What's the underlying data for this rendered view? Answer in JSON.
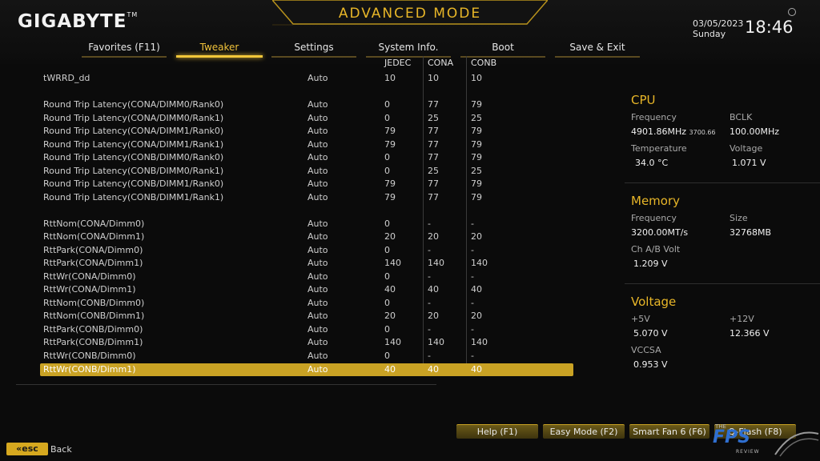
{
  "header": {
    "logo": "GIGABYTE",
    "logo_mark": "TM",
    "mode_title": "ADVANCED MODE",
    "date": "03/05/2023",
    "day": "Sunday",
    "time": "18:46"
  },
  "tabs": [
    {
      "label": "Favorites (F11)",
      "active": false
    },
    {
      "label": "Tweaker",
      "active": true
    },
    {
      "label": "Settings",
      "active": false
    },
    {
      "label": "System Info.",
      "active": false
    },
    {
      "label": "Boot",
      "active": false
    },
    {
      "label": "Save & Exit",
      "active": false
    }
  ],
  "columns": {
    "jedec": "JEDEC",
    "cona": "CONA",
    "conb": "CONB"
  },
  "rows": [
    {
      "name": "tWRRD_dd",
      "value": "Auto",
      "jedec": "10",
      "cona": "10",
      "conb": "10"
    },
    {
      "name": "Round Trip Latency(CONA/DIMM0/Rank0)",
      "value": "Auto",
      "jedec": "0",
      "cona": "77",
      "conb": "79"
    },
    {
      "name": "Round Trip Latency(CONA/DIMM0/Rank1)",
      "value": "Auto",
      "jedec": "0",
      "cona": "25",
      "conb": "25"
    },
    {
      "name": "Round Trip Latency(CONA/DIMM1/Rank0)",
      "value": "Auto",
      "jedec": "79",
      "cona": "77",
      "conb": "79"
    },
    {
      "name": "Round Trip Latency(CONA/DIMM1/Rank1)",
      "value": "Auto",
      "jedec": "79",
      "cona": "77",
      "conb": "79"
    },
    {
      "name": "Round Trip Latency(CONB/DIMM0/Rank0)",
      "value": "Auto",
      "jedec": "0",
      "cona": "77",
      "conb": "79"
    },
    {
      "name": "Round Trip Latency(CONB/DIMM0/Rank1)",
      "value": "Auto",
      "jedec": "0",
      "cona": "25",
      "conb": "25"
    },
    {
      "name": "Round Trip Latency(CONB/DIMM1/Rank0)",
      "value": "Auto",
      "jedec": "79",
      "cona": "77",
      "conb": "79"
    },
    {
      "name": "Round Trip Latency(CONB/DIMM1/Rank1)",
      "value": "Auto",
      "jedec": "79",
      "cona": "77",
      "conb": "79"
    },
    {
      "name": "RttNom(CONA/Dimm0)",
      "value": "Auto",
      "jedec": "0",
      "cona": "-",
      "conb": "-"
    },
    {
      "name": "RttNom(CONA/Dimm1)",
      "value": "Auto",
      "jedec": "20",
      "cona": "20",
      "conb": "20"
    },
    {
      "name": "RttPark(CONA/Dimm0)",
      "value": "Auto",
      "jedec": "0",
      "cona": "-",
      "conb": "-"
    },
    {
      "name": "RttPark(CONA/Dimm1)",
      "value": "Auto",
      "jedec": "140",
      "cona": "140",
      "conb": "140"
    },
    {
      "name": "RttWr(CONA/Dimm0)",
      "value": "Auto",
      "jedec": "0",
      "cona": "-",
      "conb": "-"
    },
    {
      "name": "RttWr(CONA/Dimm1)",
      "value": "Auto",
      "jedec": "40",
      "cona": "40",
      "conb": "40"
    },
    {
      "name": "RttNom(CONB/Dimm0)",
      "value": "Auto",
      "jedec": "0",
      "cona": "-",
      "conb": "-"
    },
    {
      "name": "RttNom(CONB/Dimm1)",
      "value": "Auto",
      "jedec": "20",
      "cona": "20",
      "conb": "20"
    },
    {
      "name": "RttPark(CONB/Dimm0)",
      "value": "Auto",
      "jedec": "0",
      "cona": "-",
      "conb": "-"
    },
    {
      "name": "RttPark(CONB/Dimm1)",
      "value": "Auto",
      "jedec": "140",
      "cona": "140",
      "conb": "140"
    },
    {
      "name": "RttWr(CONB/Dimm0)",
      "value": "Auto",
      "jedec": "0",
      "cona": "-",
      "conb": "-"
    },
    {
      "name": "RttWr(CONB/Dimm1)",
      "value": "Auto",
      "jedec": "40",
      "cona": "40",
      "conb": "40",
      "selected": true
    }
  ],
  "cpu": {
    "title": "CPU",
    "freq_label": "Frequency",
    "freq_value": "4901.86MHz",
    "freq_sub": "3700.66",
    "bclk_label": "BCLK",
    "bclk_value": "100.00MHz",
    "temp_label": "Temperature",
    "temp_value": "34.0 °C",
    "volt_label": "Voltage",
    "volt_value": "1.071 V"
  },
  "memory": {
    "title": "Memory",
    "freq_label": "Frequency",
    "freq_value": "3200.00MT/s",
    "size_label": "Size",
    "size_value": "32768MB",
    "volt_label": "Ch A/B Volt",
    "volt_value": "1.209 V"
  },
  "voltage": {
    "title": "Voltage",
    "v5_label": "+5V",
    "v5_value": "5.070 V",
    "v12_label": "+12V",
    "v12_value": "12.366 V",
    "vccsa_label": "VCCSA",
    "vccsa_value": "0.953 V"
  },
  "footer": {
    "help": "Help (F1)",
    "easy": "Easy Mode (F2)",
    "smartfan": "Smart Fan 6 (F6)",
    "qflash": "Q-Flash (F8)",
    "esc": "esc",
    "back": "Back"
  },
  "watermark": {
    "the": "THE",
    "fps": "FPS",
    "review": "REVIEW"
  },
  "colors": {
    "accent": "#e8b628",
    "selected_row": "#c9a224",
    "background": "#0b0b0b"
  }
}
